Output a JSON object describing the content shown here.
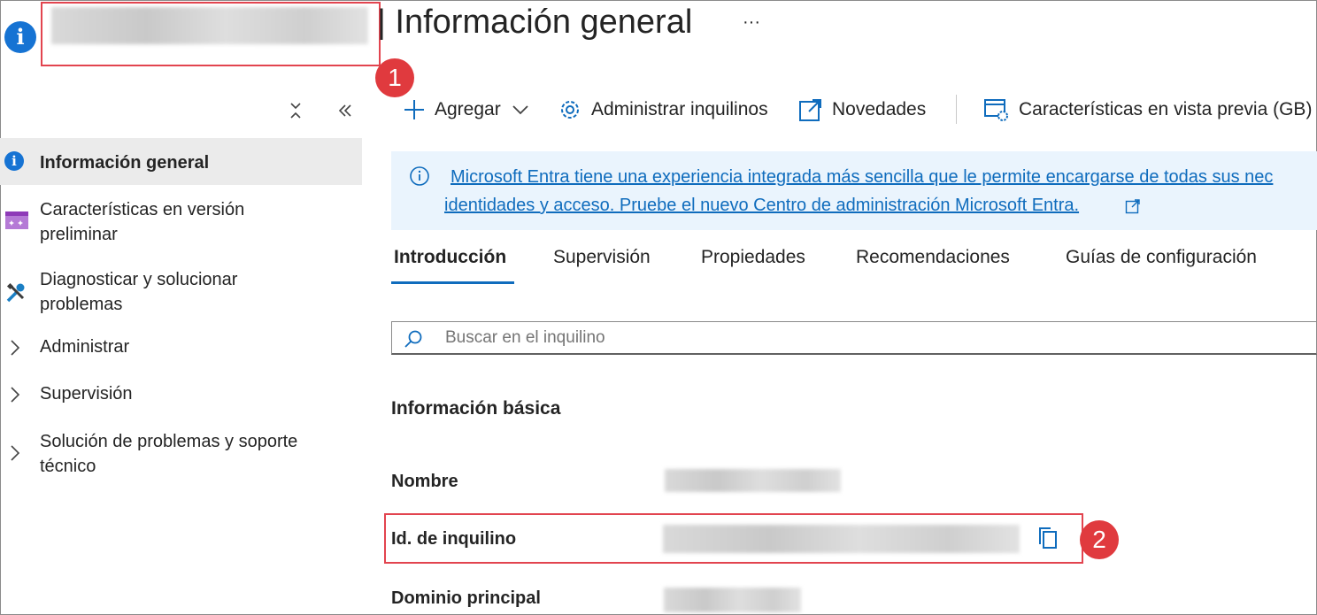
{
  "header": {
    "title": "| Información general",
    "more_label": "···"
  },
  "callouts": [
    "1",
    "2"
  ],
  "sidebar": {
    "collapse_all_label": "×",
    "collapse_panel_label": "«",
    "items": [
      {
        "label": "Información general"
      },
      {
        "label": "Características en versión preliminar"
      },
      {
        "label": "Diagnosticar y solucionar problemas"
      },
      {
        "label": "Administrar"
      },
      {
        "label": "Supervisión"
      },
      {
        "label": "Solución de problemas y soporte técnico"
      }
    ]
  },
  "toolbar": {
    "add_label": "Agregar",
    "manage_tenants_label": "Administrar inquilinos",
    "whats_new_label": "Novedades",
    "preview_features_label": "Características en vista previa (GB)"
  },
  "banner": {
    "link_line1": "Microsoft Entra tiene una experiencia integrada más sencilla que le permite encargarse de todas sus nec",
    "link_line2": "identidades y acceso. Pruebe el nuevo Centro de administración Microsoft Entra."
  },
  "tabs": [
    {
      "label": "Introducción",
      "selected": true
    },
    {
      "label": "Supervisión"
    },
    {
      "label": "Propiedades"
    },
    {
      "label": "Recomendaciones"
    },
    {
      "label": "Guías de configuración"
    }
  ],
  "search": {
    "placeholder": "Buscar en el inquilino"
  },
  "basic_info": {
    "heading": "Información básica",
    "fields": [
      {
        "label": "Nombre"
      },
      {
        "label": "Id. de inquilino"
      },
      {
        "label": "Dominio principal"
      }
    ]
  },
  "colors": {
    "accent": "#0f6cbd",
    "callout": "#e03a3e",
    "banner_bg": "#eaf4fd"
  }
}
